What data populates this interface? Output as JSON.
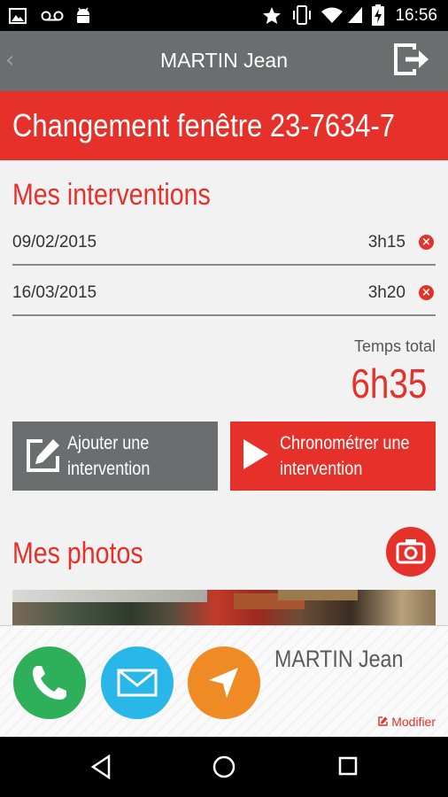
{
  "status_bar": {
    "time": "16:56",
    "icons": [
      "image-icon",
      "voicemail-icon",
      "android-icon",
      "star-icon",
      "vibrate-icon",
      "wifi-icon",
      "battery-charging-icon"
    ]
  },
  "app_bar": {
    "back_glyph": "‹",
    "title": "MARTIN Jean",
    "logout_icon": "logout-icon"
  },
  "project": {
    "title": "Changement fenêtre 23-7634-7"
  },
  "interventions": {
    "title": "Mes interventions",
    "rows": [
      {
        "date": "09/02/2015",
        "duration": "3h15"
      },
      {
        "date": "16/03/2015",
        "duration": "3h20"
      }
    ],
    "delete_glyph": "×",
    "total_label": "Temps total",
    "total_value": "6h35"
  },
  "buttons": {
    "add_label": "Ajouter une intervention",
    "timer_label": "Chronométrer une intervention"
  },
  "photos": {
    "title": "Mes photos",
    "camera_icon": "camera-icon"
  },
  "contact": {
    "name": "MARTIN Jean",
    "modify_label": "Modifier",
    "actions": [
      "phone-icon",
      "mail-icon",
      "navigation-icon"
    ]
  },
  "colors": {
    "accent_red": "#e53129",
    "header_gray": "#6a6e6f",
    "phone_green": "#2eaf5a",
    "mail_blue": "#29b6e8",
    "nav_orange": "#f08a24"
  }
}
